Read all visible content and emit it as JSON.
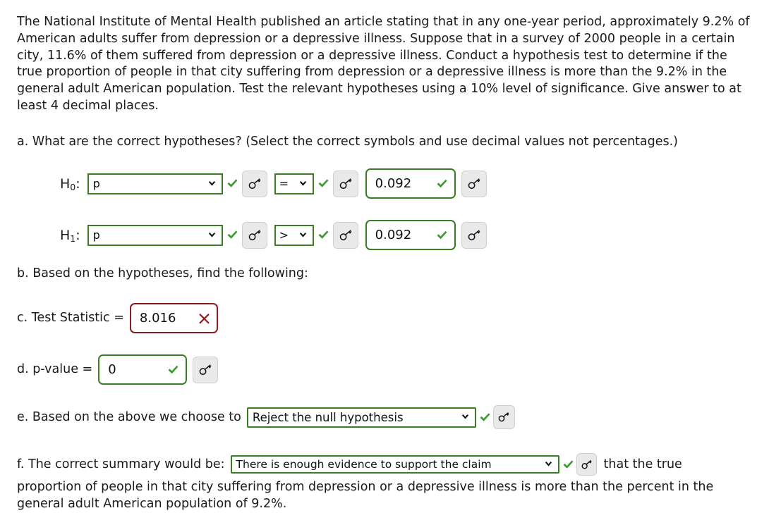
{
  "problem": {
    "text": "The National Institute of Mental Health published an article stating that in any one-year period, approximately 9.2% of American adults suffer from depression or a depressive illness. Suppose that in a survey of 2000 people in a certain city, 11.6% of them suffered from depression or a depressive illness. Conduct a hypothesis test to determine if the true proportion of people in that city suffering from depression or a depressive illness is more than the 9.2% in the general adult American population. Test the relevant hypotheses using a 10% level of significance. Give answer to at least 4 decimal places."
  },
  "parts": {
    "a": {
      "prompt": "a. What are the correct hypotheses? (Select the correct symbols and use decimal values not percentages.)",
      "h0": {
        "label": "H",
        "subscript": "0",
        "colon": ":",
        "parameter": "p",
        "operator": "=",
        "value": "0.092"
      },
      "h1": {
        "label": "H",
        "subscript": "1",
        "colon": ":",
        "parameter": "p",
        "operator": ">",
        "value": "0.092"
      }
    },
    "b": {
      "prompt": "b. Based on the hypotheses, find the following:"
    },
    "c": {
      "label": "c. Test Statistic =",
      "value": "8.016",
      "status": "incorrect"
    },
    "d": {
      "label": "d. p-value =",
      "value": "0",
      "status": "correct"
    },
    "e": {
      "label": "e. Based on the above we choose to",
      "selected": "Reject the null hypothesis",
      "status": "correct"
    },
    "f": {
      "label": "f. The correct summary would be:",
      "selected": "There is enough evidence to support the claim",
      "trailing": "that the true",
      "continuation": "proportion of people in that city suffering from depression or a depressive illness is more than the percent in the general adult American population of 9.2%.",
      "status": "correct"
    }
  },
  "icons": {
    "key": "key-icon",
    "check": "check-icon",
    "cross": "cross-icon",
    "chevron": "chevron-down-icon"
  },
  "colors": {
    "correct_green": "#3a7d22",
    "check_green": "#3c9a31",
    "incorrect_red": "#8a1d1d",
    "button_gray": "#e9e9e9",
    "text": "#1a1a1a"
  }
}
